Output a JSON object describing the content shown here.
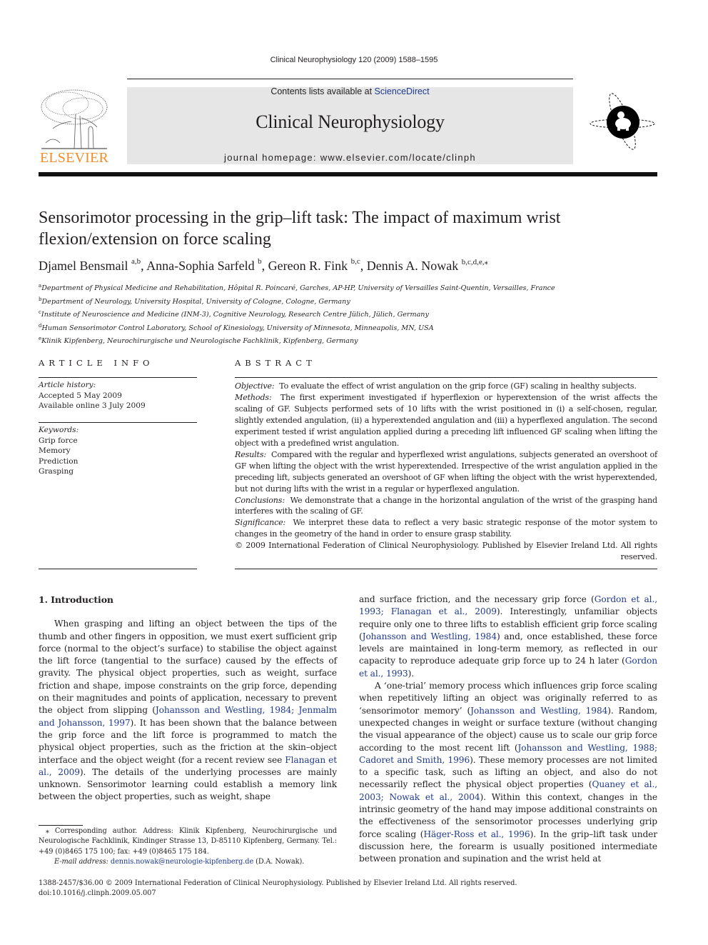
{
  "running_head": "Clinical Neurophysiology 120 (2009) 1588–1595",
  "banner": {
    "contents_prefix": "Contents lists available at ",
    "contents_link": "ScienceDirect",
    "journal_title": "Clinical Neurophysiology",
    "homepage": "journal homepage: www.elsevier.com/locate/clinph",
    "publisher_wordmark": "ELSEVIER",
    "publisher_color": "#f28c28",
    "link_color": "#1f3a8f",
    "banner_bg": "#e6e6e6"
  },
  "article": {
    "title": "Sensorimotor processing in the grip–lift task: The impact of maximum wrist flexion/extension on force scaling",
    "authors": [
      {
        "name": "Djamel Bensmail",
        "sup": "a,b",
        "sep": ", "
      },
      {
        "name": "Anna-Sophia Sarfeld",
        "sup": "b",
        "sep": ", "
      },
      {
        "name": "Gereon R. Fink",
        "sup": "b,c",
        "sep": ", "
      },
      {
        "name": "Dennis A. Nowak",
        "sup": "b,c,d,e,⁎",
        "sep": ""
      }
    ],
    "affiliations": [
      {
        "key": "a",
        "text": "Department of Physical Medicine and Rehabilitation, Hôpital R. Poincaré, Garches, AP-HP, University of Versailles Saint-Quentin, Versailles, France"
      },
      {
        "key": "b",
        "text": "Department of Neurology, University Hospital, University of Cologne, Cologne, Germany"
      },
      {
        "key": "c",
        "text": "Institute of Neuroscience and Medicine (INM-3), Cognitive Neurology, Research Centre Jülich, Jülich, Germany"
      },
      {
        "key": "d",
        "text": "Human Sensorimotor Control Laboratory, School of Kinesiology, University of Minnesota, Minneapolis, MN, USA"
      },
      {
        "key": "e",
        "text": "Klinik Kipfenberg, Neurochirurgische und Neurologische Fachklinik, Kipfenberg, Germany"
      }
    ]
  },
  "article_info": {
    "heading": "ARTICLE INFO",
    "history_label": "Article history:",
    "accepted": "Accepted 5 May 2009",
    "available": "Available online 3 July 2009",
    "keywords_label": "Keywords:",
    "keywords": [
      "Grip force",
      "Memory",
      "Prediction",
      "Grasping"
    ]
  },
  "abstract": {
    "heading": "ABSTRACT",
    "sections": [
      {
        "label": "Objective:",
        "text": "To evaluate the effect of wrist angulation on the grip force (GF) scaling in healthy subjects."
      },
      {
        "label": "Methods:",
        "text": "The first experiment investigated if hyperflexion or hyperextension of the wrist affects the scaling of GF. Subjects performed sets of 10 lifts with the wrist positioned in (i) a self-chosen, regular, slightly extended angulation, (ii) a hyperextended angulation and (iii) a hyperflexed angulation. The second experiment tested if wrist angulation applied during a preceding lift influenced GF scaling when lifting the object with a predefined wrist angulation."
      },
      {
        "label": "Results:",
        "text": "Compared with the regular and hyperflexed wrist angulations, subjects generated an overshoot of GF when lifting the object with the wrist hyperextended. Irrespective of the wrist angulation applied in the preceding lift, subjects generated an overshoot of GF when lifting the object with the wrist hyperextended, but not during lifts with the wrist in a regular or hyperflexed angulation."
      },
      {
        "label": "Conclusions:",
        "text": "We demonstrate that a change in the horizontal angulation of the wrist of the grasping hand interferes with the scaling of GF."
      },
      {
        "label": "Significance:",
        "text": "We interpret these data to reflect a very basic strategic response of the motor system to changes in the geometry of the hand in order to ensure grasp stability."
      }
    ],
    "copyright": "© 2009 International Federation of Clinical Neurophysiology. Published by Elsevier Ireland Ltd. All rights reserved."
  },
  "body": {
    "intro_heading": "1. Introduction",
    "left_p1": [
      {
        "t": "When grasping and lifting an object between the tips of the thumb and other fingers in opposition, we must exert sufficient grip force (normal to the object’s surface) to stabilise the object against the lift force (tangential to the surface) caused by the effects of gravity. The physical object properties, such as weight, surface friction and shape, impose constraints on the grip force, depending on their magnitudes and points of application, necessary to prevent the object from slipping ("
      },
      {
        "t": "Johansson and Westling, 1984; Jenmalm and Johansson, 1997",
        "link": true
      },
      {
        "t": "). It has been shown that the balance between the grip force and the lift force is programmed to match the physical object properties, such as the friction at the skin–object interface and the object weight (for a recent review see "
      },
      {
        "t": "Flanagan et al., 2009",
        "link": true
      },
      {
        "t": "). The details of the underlying processes are mainly unknown. Sensorimotor learning could establish a memory link between the object properties, such as weight, shape"
      }
    ],
    "right_p1": [
      {
        "t": "and surface friction, and the necessary grip force ("
      },
      {
        "t": "Gordon et al., 1993; Flanagan et al., 2009",
        "link": true
      },
      {
        "t": "). Interestingly, unfamiliar objects require only one to three lifts to establish efficient grip force scaling ("
      },
      {
        "t": "Johansson and Westling, 1984",
        "link": true
      },
      {
        "t": ") and, once established, these force levels are maintained in long-term memory, as reflected in our capacity to reproduce adequate grip force up to 24 h later ("
      },
      {
        "t": "Gordon et al., 1993",
        "link": true
      },
      {
        "t": ")."
      }
    ],
    "right_p2": [
      {
        "t": "A ‘one-trial’ memory process which influences grip force scaling when repetitively lifting an object was originally referred to as ‘sensorimotor memory’ ("
      },
      {
        "t": "Johansson and Westling, 1984",
        "link": true
      },
      {
        "t": "). Random, unexpected changes in weight or surface texture (without changing the visual appearance of the object) cause us to scale our grip force according to the most recent lift ("
      },
      {
        "t": "Johansson and Westling, 1988; Cadoret and Smith, 1996",
        "link": true
      },
      {
        "t": "). These memory processes are not limited to a specific task, such as lifting an object, and also do not necessarily reflect the physical object properties ("
      },
      {
        "t": "Quaney et al., 2003; Nowak et al., 2004",
        "link": true
      },
      {
        "t": "). Within this context, changes in the intrinsic geometry of the hand may impose additional constraints on the effectiveness of the sensorimotor processes underlying grip force scaling ("
      },
      {
        "t": "Häger-Ross et al., 1996",
        "link": true
      },
      {
        "t": "). In the grip–lift task under discussion here, the forearm is usually positioned intermediate between pronation and supination and the wrist held at"
      }
    ]
  },
  "footnote": {
    "corresponding": "⁎ Corresponding author. Address: Klinik Kipfenberg, Neurochirurgische und Neurologische Fachklinik, Kindinger Strasse 13, D-85110 Kipfenberg, Germany. Tel.: +49 (0)8465 175 100; fax: +49 (0)8465 175 184.",
    "email_label": "E-mail address:",
    "email": "dennis.nowak@neurologie-kipfenberg.de",
    "email_suffix": " (D.A. Nowak)."
  },
  "footer": {
    "issn_line": "1388-2457/$36.00 © 2009 International Federation of Clinical Neurophysiology. Published by Elsevier Ireland Ltd. All rights reserved.",
    "doi": "doi:10.1016/j.clinph.2009.05.007"
  }
}
